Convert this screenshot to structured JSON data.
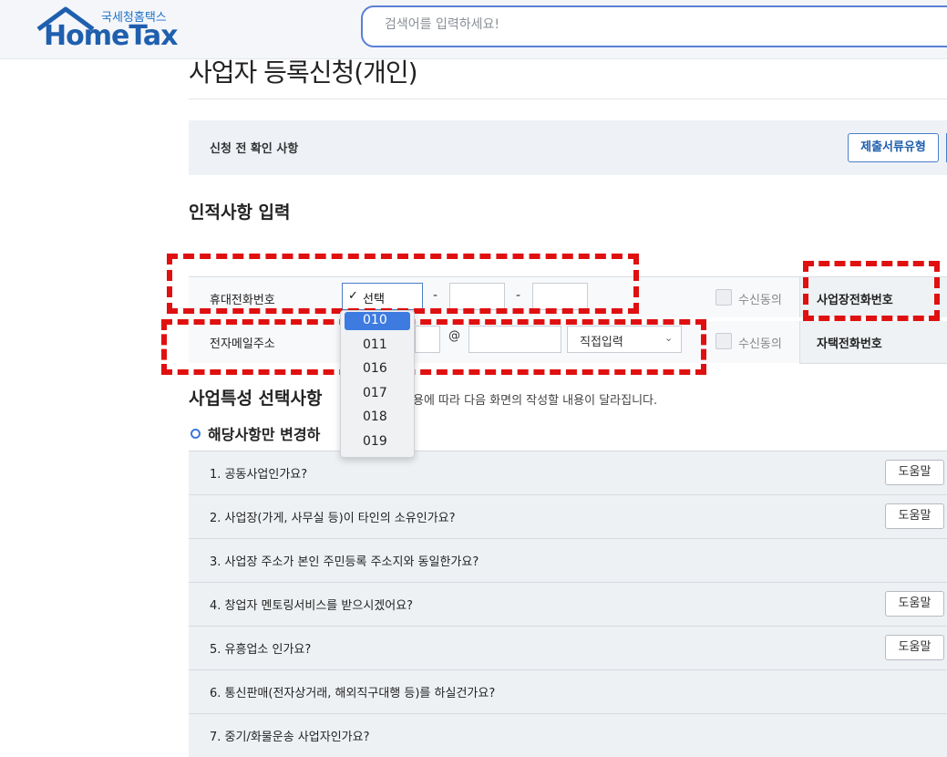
{
  "header": {
    "logo_sub": "국세청홈택스",
    "logo_main": "HomeTax",
    "search_placeholder": "검색어를 입력하세요!"
  },
  "page": {
    "title": "사업자 등록신청(개인)",
    "pre_check_label": "신청 전 확인 사항",
    "doc_type_button": "제출서류유형"
  },
  "personal_info": {
    "heading": "인적사항 입력",
    "phone_label": "휴대전화번호",
    "phone_dash": "-",
    "email_label": "전자메일주소",
    "email_at": "@",
    "email_domain_select": "직접입력",
    "consent_label": "수신동의",
    "biz_phone_label": "사업장전화번호",
    "home_phone_label": "자택전화번호"
  },
  "phone_prefix_dropdown": {
    "selected_label": "선택",
    "check_mark": "✓",
    "options": [
      "010",
      "011",
      "016",
      "017",
      "018",
      "019"
    ],
    "highlighted_index": 0
  },
  "business": {
    "heading": "사업특성 선택사항",
    "note": "용에 따라 다음 화면의 작성할 내용이 달라집니다.",
    "sub_title": "해당사항만 변경하",
    "help_label": "도움말",
    "questions": [
      {
        "label": "1. 공동사업인가요?",
        "has_help": true
      },
      {
        "label": "2. 사업장(가게, 사무실 등)이 타인의 소유인가요?",
        "has_help": true
      },
      {
        "label": "3. 사업장 주소가 본인 주민등록 주소지와 동일한가요?",
        "has_help": false
      },
      {
        "label": "4. 창업자 멘토링서비스를 받으시겠어요?",
        "has_help": true
      },
      {
        "label": "5. 유흥업소 인가요?",
        "has_help": true
      },
      {
        "label": "6. 통신판매(전자상거래, 해외직구대행 등)를 하실건가요?",
        "has_help": false
      },
      {
        "label": "7. 중기/화물운송 사업자인가요?",
        "has_help": false
      }
    ]
  },
  "colors": {
    "brand": "#1f5fae",
    "annotation_red": "#e01010",
    "dropdown_highlight": "#3d7be0"
  }
}
